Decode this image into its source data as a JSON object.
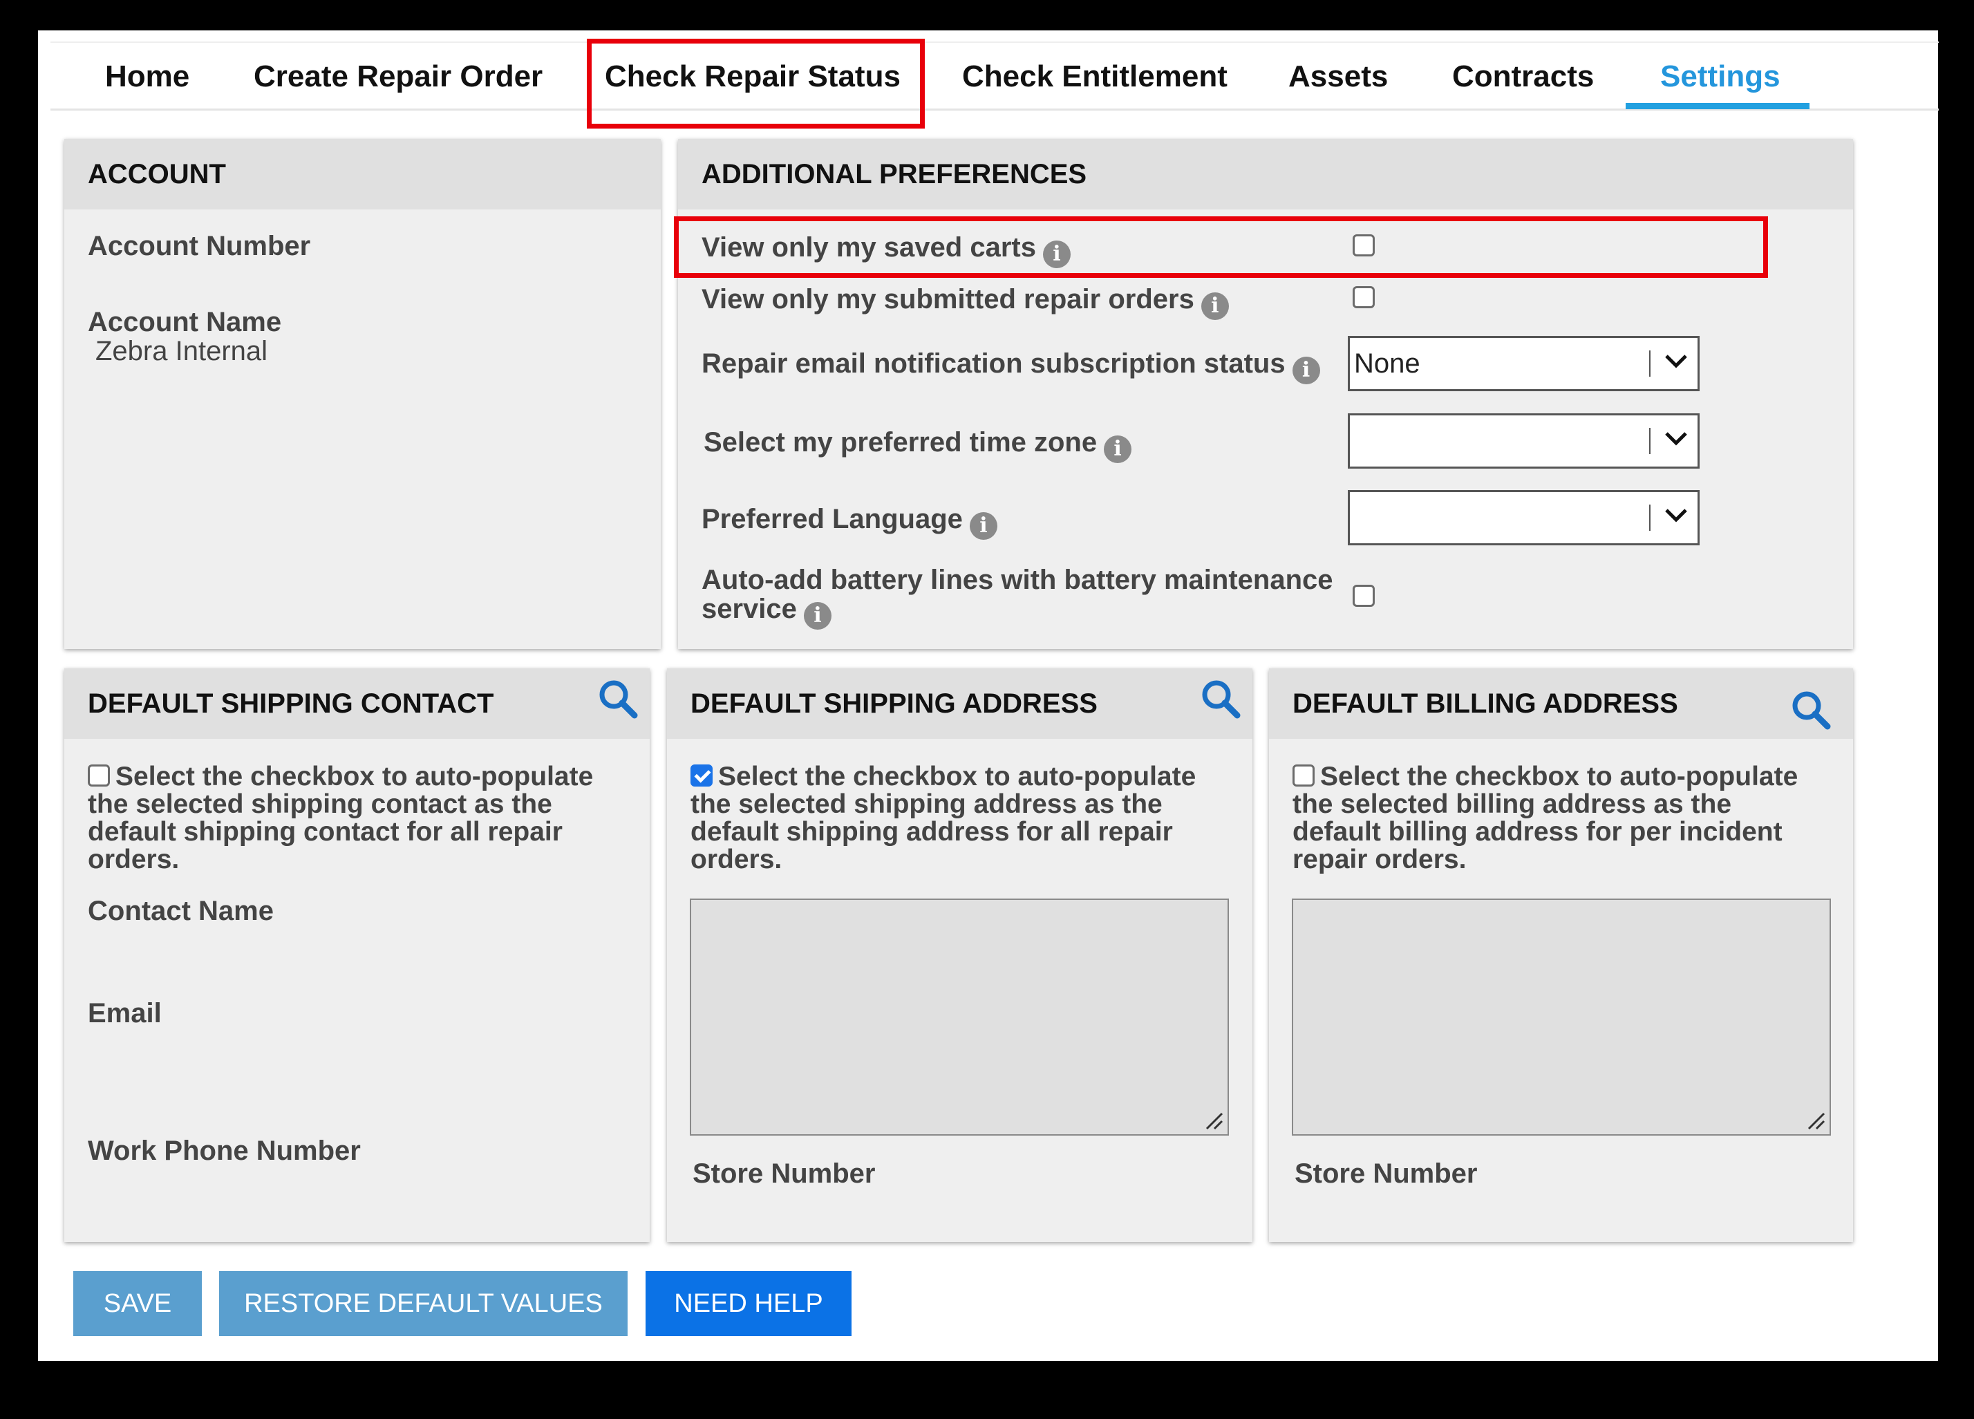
{
  "nav": {
    "tabs": [
      {
        "label": "Home"
      },
      {
        "label": "Create Repair Order"
      },
      {
        "label": "Check Repair Status"
      },
      {
        "label": "Check Entitlement"
      },
      {
        "label": "Assets"
      },
      {
        "label": "Contracts"
      },
      {
        "label": "Settings",
        "active": true
      }
    ]
  },
  "account": {
    "title": "ACCOUNT",
    "account_number_label": "Account Number",
    "account_name_label": "Account Name",
    "account_name_value": "Zebra Internal"
  },
  "preferences": {
    "title": "ADDITIONAL PREFERENCES",
    "view_saved_carts": {
      "label": "View only my saved carts",
      "checked": false
    },
    "view_submitted_orders": {
      "label": "View only my submitted repair orders",
      "checked": false
    },
    "email_notification": {
      "label": "Repair email notification subscription status",
      "value": "None"
    },
    "time_zone": {
      "label": "Select my preferred time zone",
      "value": ""
    },
    "language": {
      "label": "Preferred Language",
      "value": ""
    },
    "battery_lines": {
      "label_line1": "Auto-add battery lines with battery maintenance",
      "label_line2": "service",
      "checked": false
    }
  },
  "shipping_contact": {
    "title": "DEFAULT SHIPPING CONTACT",
    "checkbox_checked": false,
    "description_line1": "Select the checkbox to auto-populate",
    "description_line2": "the selected shipping contact as the",
    "description_line3": "default shipping contact for all repair",
    "description_line4": "orders.",
    "contact_name_label": "Contact Name",
    "email_label": "Email",
    "work_phone_label": "Work Phone Number"
  },
  "shipping_address": {
    "title": "DEFAULT SHIPPING ADDRESS",
    "checkbox_checked": true,
    "description_line1": "Select the checkbox to auto-populate",
    "description_line2": "the selected shipping address as the",
    "description_line3": "default shipping address for all repair",
    "description_line4": "orders.",
    "store_number_label": "Store Number"
  },
  "billing_address": {
    "title": "DEFAULT BILLING ADDRESS",
    "checkbox_checked": false,
    "description_line1": "Select the checkbox to auto-populate",
    "description_line2": "the selected billing address as the",
    "description_line3": "default billing address for per incident",
    "description_line4": "repair orders.",
    "store_number_label": "Store Number"
  },
  "actions": {
    "save_label": "SAVE",
    "restore_label": "RESTORE DEFAULT VALUES",
    "help_label": "NEED HELP"
  },
  "icons": {
    "info": "info-icon",
    "search": "search-icon",
    "dropdown": "chevron-down-icon"
  },
  "colors": {
    "accent": "#22a0e0",
    "highlight": "#e8000a",
    "save_button": "#5a9fcf",
    "help_button": "#0b72e6"
  }
}
